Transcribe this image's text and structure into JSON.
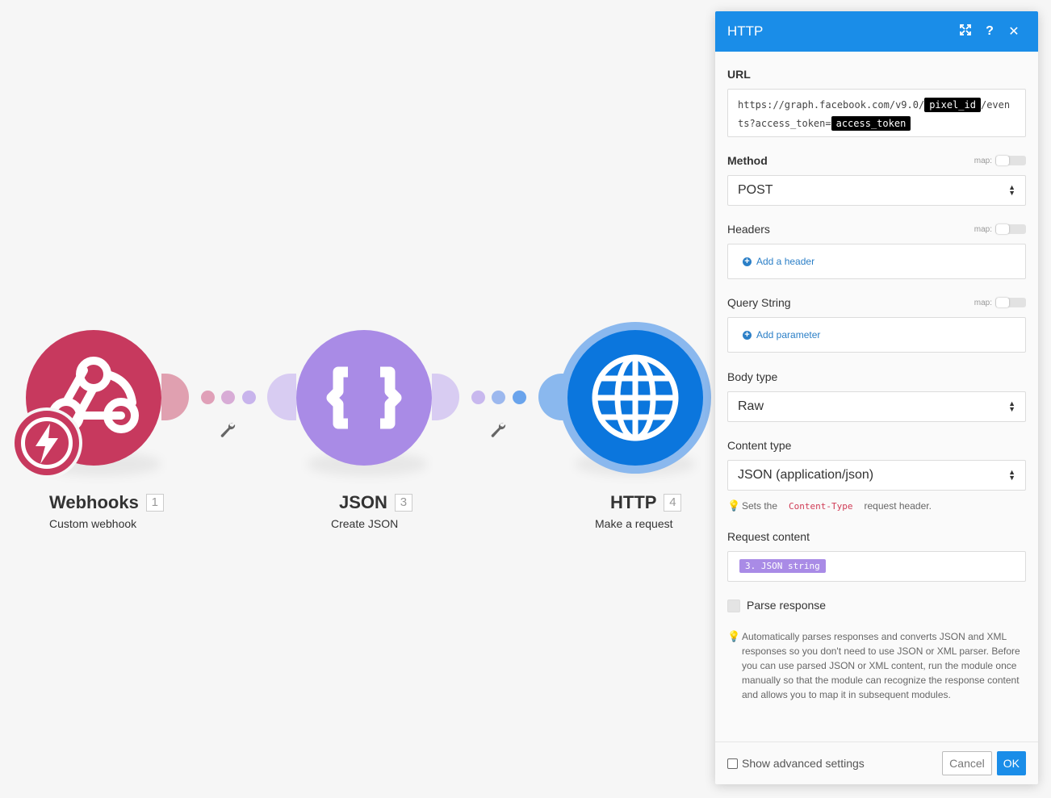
{
  "colors": {
    "accent": "#1a8de8",
    "webhooks": "#c7395e",
    "json": "#a98be6",
    "http": "#0b76dd"
  },
  "modules": [
    {
      "name": "Webhooks",
      "number": "1",
      "subtitle": "Custom webhook",
      "icon": "webhook-icon"
    },
    {
      "name": "JSON",
      "number": "3",
      "subtitle": "Create JSON",
      "icon": "braces-icon"
    },
    {
      "name": "HTTP",
      "number": "4",
      "subtitle": "Make a request",
      "icon": "globe-icon"
    }
  ],
  "panel": {
    "title": "HTTP",
    "url": {
      "label": "URL",
      "part1": "https://graph.facebook.com/v9.0/",
      "token1": "pixel_id",
      "part2": "/even",
      "part3": "ts?access_token=",
      "token2": "access_token"
    },
    "map_label": "map:",
    "method": {
      "label": "Method",
      "value": "POST"
    },
    "headers": {
      "label": "Headers",
      "add": "Add a header"
    },
    "query": {
      "label": "Query String",
      "add": "Add parameter"
    },
    "body_type": {
      "label": "Body type",
      "value": "Raw"
    },
    "content_type": {
      "label": "Content type",
      "value": "JSON (application/json)",
      "hint_pre": "Sets the",
      "hint_code": "Content-Type",
      "hint_post": "request header."
    },
    "request_content": {
      "label": "Request content",
      "token": "3. JSON string"
    },
    "parse": {
      "label": "Parse response",
      "hint": "Automatically parses responses and converts JSON and XML responses so you don't need to use JSON or XML parser. Before you can use parsed JSON or XML content, run the module once manually so that the module can recognize the response content and allows you to map it in subsequent modules."
    },
    "footer": {
      "advanced": "Show advanced settings",
      "cancel": "Cancel",
      "ok": "OK"
    }
  }
}
